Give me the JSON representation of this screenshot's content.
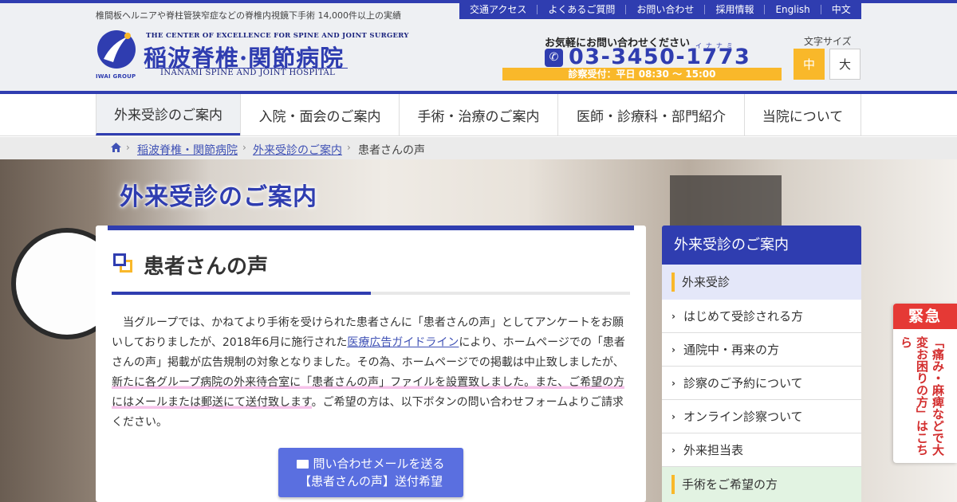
{
  "header": {
    "tagline": "椎間板ヘルニアや脊柱管狭窄症などの脊椎内視鏡下手術 14,000件以上の実績",
    "top_links": [
      "交通アクセス",
      "よくあるご質問",
      "お問い合わせ",
      "採用情報",
      "English",
      "中文"
    ],
    "logo": {
      "group": "IWAI GROUP",
      "en_top": "THE CENTER OF EXCELLENCE FOR SPINE AND JOINT SURGERY",
      "jp": "稲波脊椎·関節病院",
      "en_bottom": "INANAMI SPINE AND JOINT HOSPITAL"
    },
    "contact": {
      "lead": "お気軽にお問い合わせください",
      "phone": "03-3450-1773",
      "phone_ruby": "イナナミ",
      "hours": "診察受付：平日 08:30 〜 15:00"
    },
    "font_size": {
      "label": "文字サイズ",
      "medium": "中",
      "large": "大"
    }
  },
  "nav": {
    "items": [
      "外来受診のご案内",
      "入院・面会のご案内",
      "手術・治療のご案内",
      "医師・診療科・部門紹介",
      "当院について"
    ]
  },
  "breadcrumb": {
    "items": [
      "稲波脊椎・関節病院",
      "外来受診のご案内",
      "患者さんの声"
    ]
  },
  "hero": {
    "title": "外来受診のご案内"
  },
  "main": {
    "title": "患者さんの声",
    "body_1": "　当グループでは、かねてより手術を受けられた患者さんに「患者さんの声」としてアンケートをお願いしておりましたが、2018年6月に施行された",
    "body_link": "医療広告ガイドライン",
    "body_2": "により、ホームページでの「患者さんの声」掲載が広告規制の対象となりました。その為、ホームページでの掲載は中止致しましたが、",
    "body_highlight": "新たに各グループ病院の外来待合室に「患者さんの声」ファイルを設置致しました。また、ご希望の方にはメールまたは郵送にて送付致します",
    "body_3": "。ご希望の方は、以下ボタンの問い合わせフォームよりご請求ください。",
    "button_line1": "問い合わせメールを送る",
    "button_line2": "【患者さんの声】送付希望"
  },
  "sidebar": {
    "heading": "外来受診のご案内",
    "category_1": "外来受診",
    "items": [
      "はじめて受診される方",
      "通院中・再来の方",
      "診察のご予約について",
      "オンライン診察ついて",
      "外来担当表"
    ],
    "category_2": "手術をご希望の方"
  },
  "emergency": {
    "label": "緊急",
    "text": "「痛み・麻痺などで大変お困りの方」はこちら"
  },
  "colors": {
    "brand_blue": "#2f3db0",
    "accent_orange": "#f9b82a",
    "emergency_red": "#e53935"
  }
}
